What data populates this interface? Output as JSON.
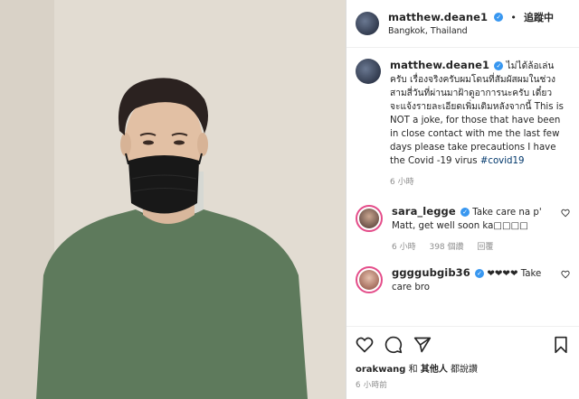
{
  "post": {
    "author": "matthew.deane1",
    "follow_label": "追蹤中",
    "location": "Bangkok, Thailand",
    "caption": {
      "text": "ไม่ได้ล้อเล่นครับ เรื่องจริงครับผมโดนที่สัมผัสผมในช่วงสามสี่วันที่ผ่านมาฝ้าดูอาการนะครับ เดี๋ยวจะแจ้งรายละเอียดเพิ่มเติมหลังจากนี้ This is NOT a joke, for those that have been in close contact with me the last few days please take precautions I have the Covid -19 virus",
      "hashtag": "#covid19",
      "time": "6 小時"
    },
    "comments": [
      {
        "user": "sara_legge",
        "text": "Take care na p' Matt, get well soon ka□□□□",
        "time": "6 小時",
        "likes": "398 個讚",
        "reply": "回覆"
      },
      {
        "user": "ggggubgib36",
        "text": "❤❤❤❤ Take care bro"
      }
    ],
    "liked_by": {
      "user": "orakwang",
      "connector": "和",
      "others": "其他人",
      "suffix": "都說讚"
    },
    "timestamp": "6 小時前"
  },
  "icons": [
    "heart-icon",
    "comment-icon",
    "share-icon",
    "save-icon",
    "verified-icon"
  ],
  "colors": {
    "link": "#00376b",
    "verified": "#3897f0",
    "muted": "#8e8e8e"
  }
}
